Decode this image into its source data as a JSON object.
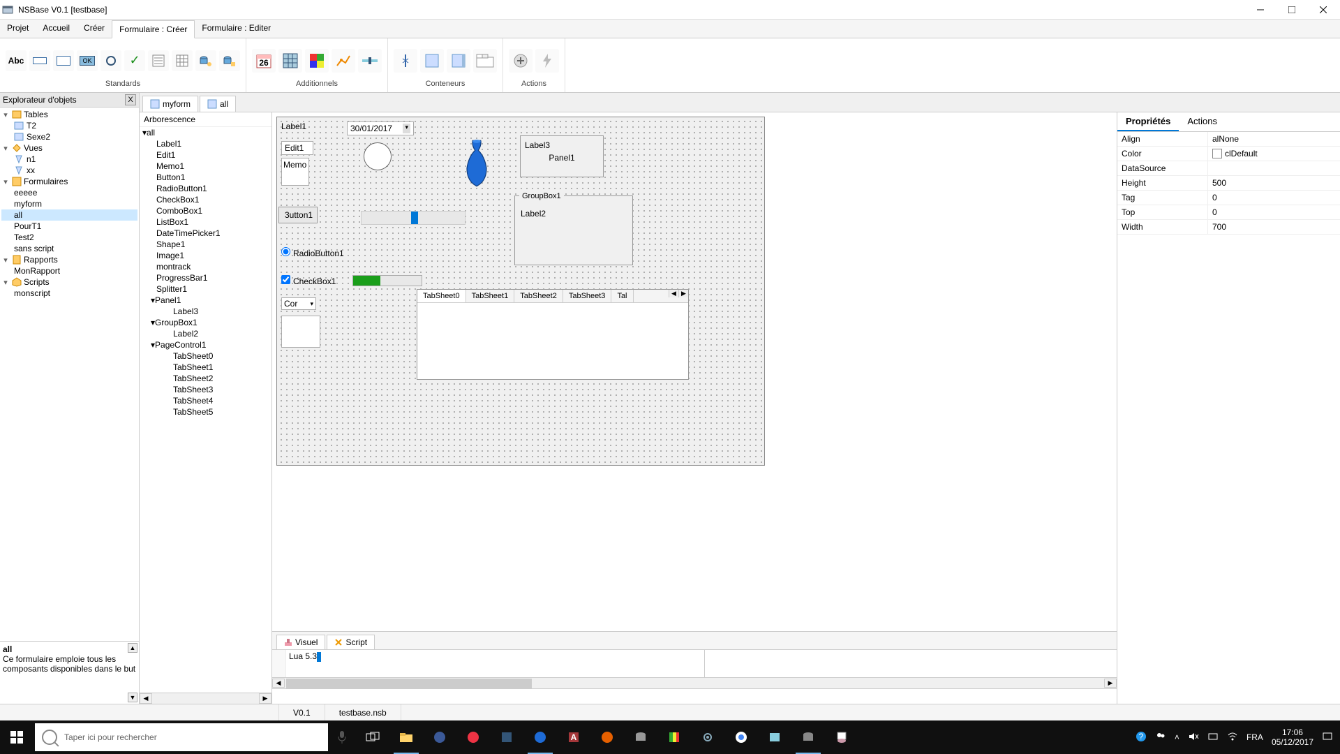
{
  "window": {
    "title": "NSBase V0.1 [testbase]"
  },
  "menu": {
    "items": [
      "Projet",
      "Accueil",
      "Créer",
      "Formulaire : Créer",
      "Formulaire : Editer"
    ],
    "active_index": 3
  },
  "ribbon": {
    "groups": {
      "standards": {
        "label": "Standards",
        "tools": [
          "label",
          "edit",
          "memo",
          "button",
          "toggle",
          "check",
          "listbox",
          "stringgrid",
          "link1",
          "link2"
        ]
      },
      "additionnels": {
        "label": "Additionnels",
        "tools": [
          "calendar",
          "grid",
          "colorgrid",
          "chart",
          "track"
        ]
      },
      "conteneurs": {
        "label": "Conteneurs",
        "tools": [
          "splitter",
          "panel",
          "scroll",
          "tab"
        ]
      },
      "actions": {
        "label": "Actions",
        "tools": [
          "plus",
          "flash"
        ]
      }
    }
  },
  "explorer": {
    "title": "Explorateur d'objets",
    "close": "X",
    "tables": {
      "label": "Tables",
      "children": [
        "T2",
        "Sexe2"
      ]
    },
    "vues": {
      "label": "Vues",
      "children": [
        "n1",
        "xx"
      ]
    },
    "formulaires": {
      "label": "Formulaires",
      "children": [
        "eeeee",
        "myform",
        "all",
        "PourT1",
        "Test2",
        "sans script"
      ],
      "selected": "all"
    },
    "rapports": {
      "label": "Rapports",
      "children": [
        "MonRapport"
      ]
    },
    "scripts": {
      "label": "Scripts",
      "children": [
        "monscript"
      ]
    }
  },
  "description": {
    "title": "all",
    "text": "Ce formulaire emploie tous les composants disponibles dans le but"
  },
  "doctabs": {
    "items": [
      "myform",
      "all"
    ],
    "active_index": 1
  },
  "arborescence": {
    "title": "Arborescence",
    "root": "all",
    "children": [
      "Label1",
      "Edit1",
      "Memo1",
      "Button1",
      "RadioButton1",
      "CheckBox1",
      "ComboBox1",
      "ListBox1",
      "DateTimePicker1",
      "Shape1",
      "Image1",
      "montrack",
      "ProgressBar1",
      "Splitter1"
    ],
    "panel": {
      "name": "Panel1",
      "children": [
        "Label3"
      ]
    },
    "group": {
      "name": "GroupBox1",
      "children": [
        "Label2"
      ]
    },
    "page": {
      "name": "PageControl1",
      "children": [
        "TabSheet0",
        "TabSheet1",
        "TabSheet2",
        "TabSheet3",
        "TabSheet4",
        "TabSheet5"
      ]
    }
  },
  "canvas": {
    "label1": "Label1",
    "date": "30/01/2017",
    "edit1": "Edit1",
    "memo": "Memo",
    "button1": "3utton1",
    "radio": "RadioButton1",
    "check": "CheckBox1",
    "combo": "Cor",
    "label3": "Label3",
    "panel1": "Panel1",
    "groupbox": "GroupBox1",
    "label2": "Label2",
    "tabs": [
      "TabSheet0",
      "TabSheet1",
      "TabSheet2",
      "TabSheet3",
      "Tal"
    ]
  },
  "design_tabs": {
    "items": [
      "Visuel",
      "Script"
    ],
    "active_index": 0
  },
  "script": {
    "code": "Lua 5.3"
  },
  "properties": {
    "tabs": [
      "Propriétés",
      "Actions"
    ],
    "active_index": 0,
    "rows": [
      {
        "key": "Align",
        "val": "alNone"
      },
      {
        "key": "Color",
        "val": "clDefault",
        "has_swatch": true
      },
      {
        "key": "DataSource",
        "val": ""
      },
      {
        "key": "Height",
        "val": "500"
      },
      {
        "key": "Tag",
        "val": "0"
      },
      {
        "key": "Top",
        "val": "0"
      },
      {
        "key": "Width",
        "val": "700"
      }
    ]
  },
  "status": {
    "version": "V0.1",
    "file": "testbase.nsb"
  },
  "taskbar": {
    "search_placeholder": "Taper ici pour rechercher",
    "lang": "FRA",
    "time": "17:06",
    "date": "05/12/2017"
  }
}
